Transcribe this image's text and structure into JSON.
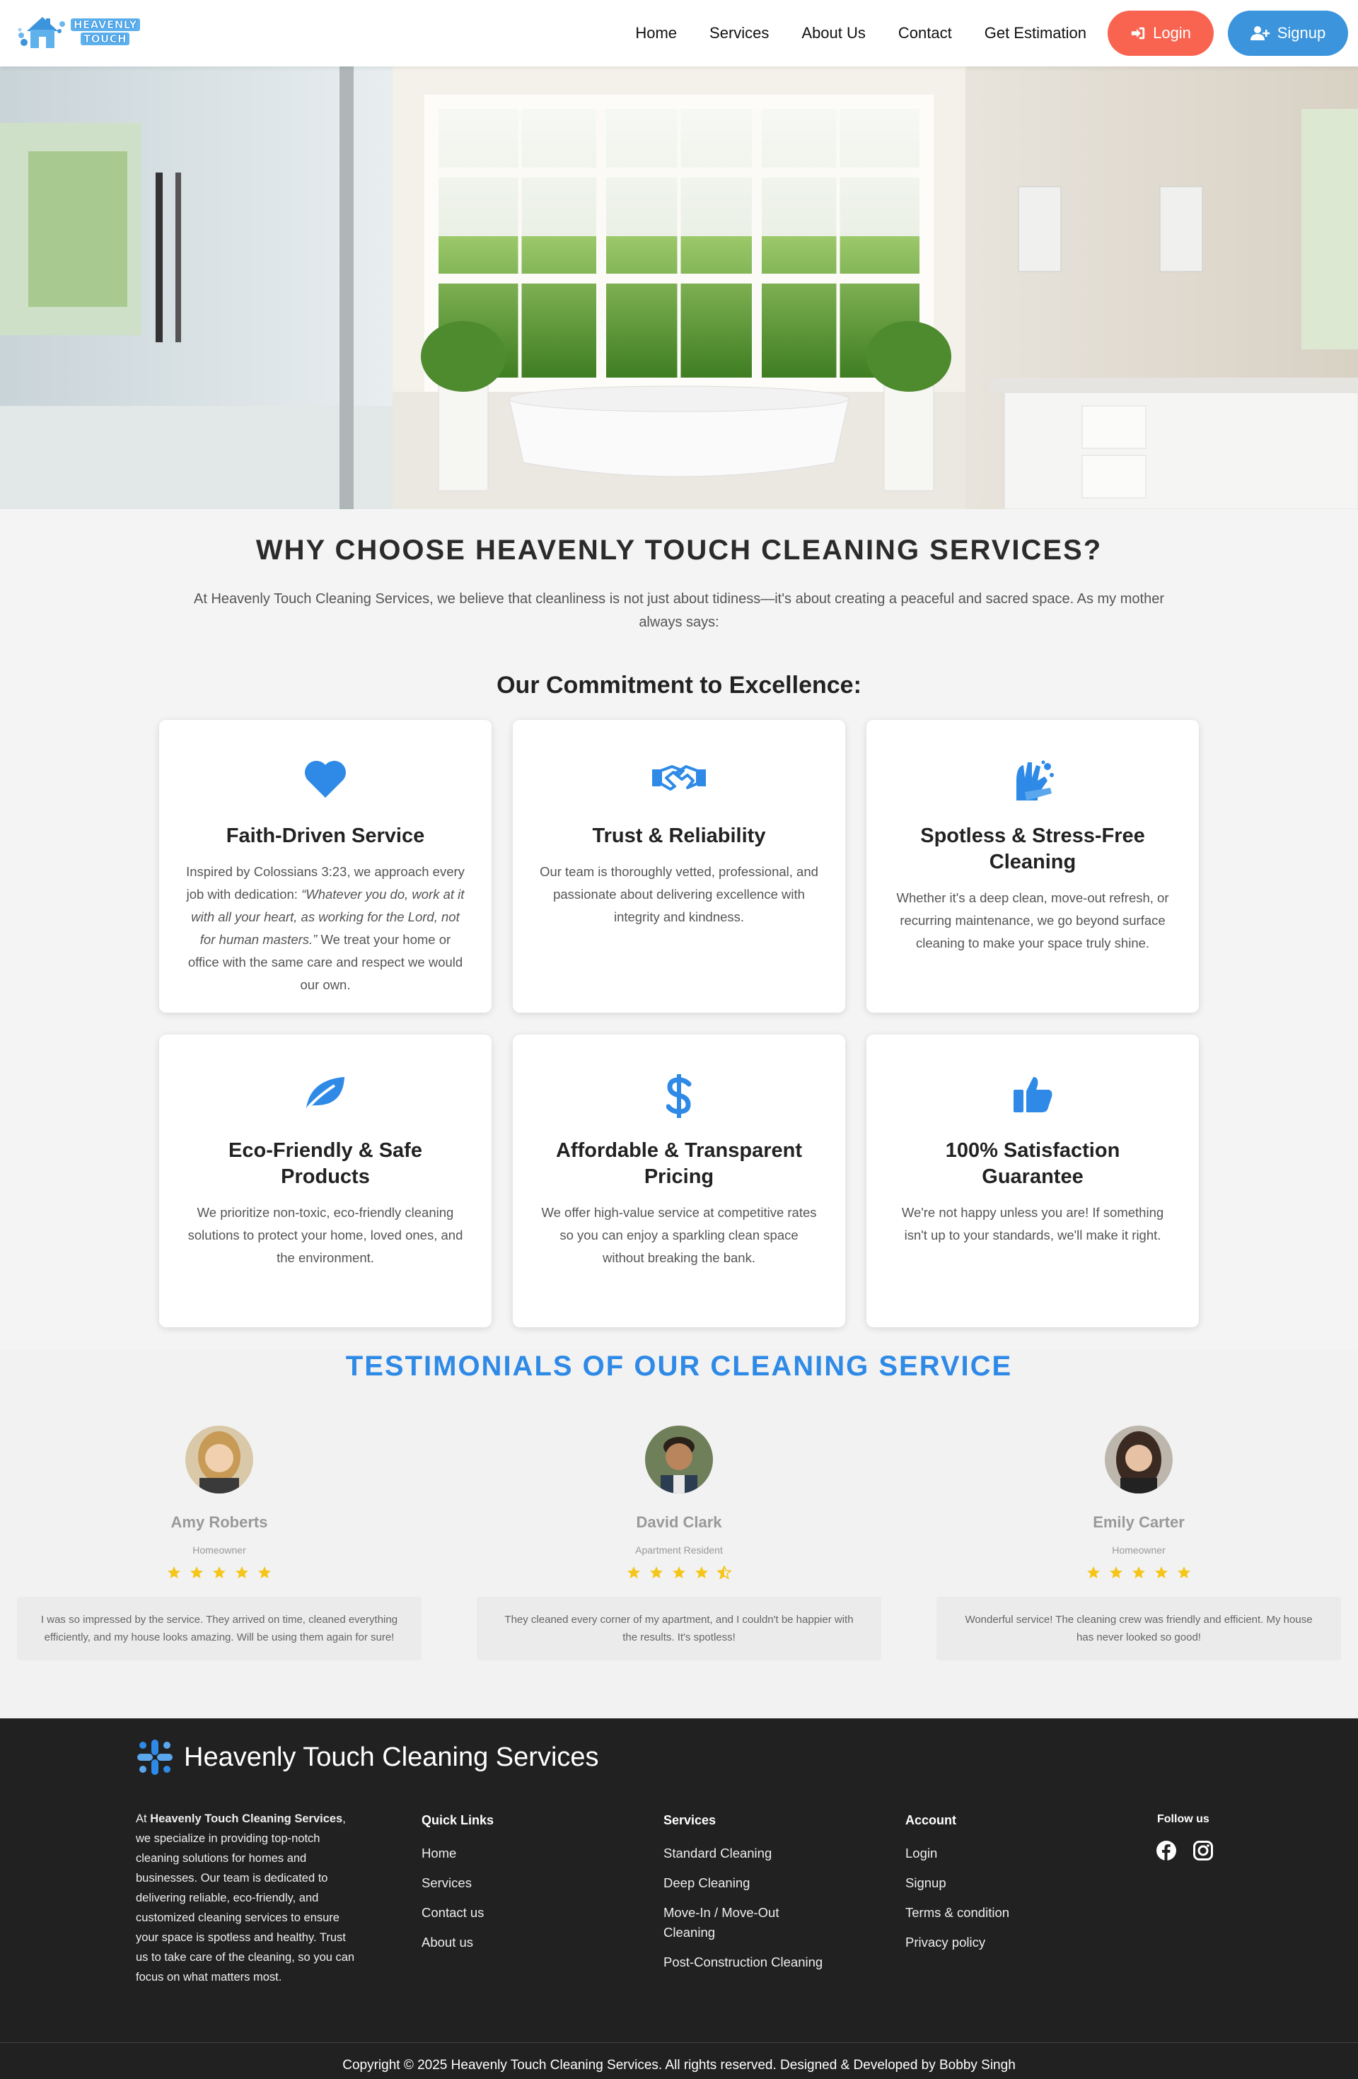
{
  "header": {
    "logo_line1": "HEAVENLY",
    "logo_line2": "TOUCH",
    "nav": [
      "Home",
      "Services",
      "About Us",
      "Contact",
      "Get Estimation"
    ],
    "login_label": "Login",
    "signup_label": "Signup"
  },
  "why": {
    "title": "WHY CHOOSE HEAVENLY TOUCH CLEANING SERVICES?",
    "intro": "At Heavenly Touch Cleaning Services, we believe that cleanliness is not just about tidiness—it's about creating a peaceful and sacred space. As my mother always says:",
    "commitment_title": "Our Commitment to Excellence:"
  },
  "cards": [
    {
      "icon": "heart-icon",
      "title": "Faith-Driven Service",
      "text_before": "Inspired by Colossians 3:23, we approach every job with dedication: ",
      "quote": "“Whatever you do, work at it with all your heart, as working for the Lord, not for human masters.”",
      "text_after": " We treat your home or office with the same care and respect we would our own."
    },
    {
      "icon": "handshake-icon",
      "title": "Trust & Reliability",
      "text": "Our team is thoroughly vetted, professional, and passionate about delivering excellence with integrity and kindness."
    },
    {
      "icon": "hands-clean-icon",
      "title": "Spotless & Stress-Free Cleaning",
      "text": "Whether it's a deep clean, move-out refresh, or recurring maintenance, we go beyond surface cleaning to make your space truly shine."
    },
    {
      "icon": "leaf-icon",
      "title": "Eco-Friendly & Safe Products",
      "text": "We prioritize non-toxic, eco-friendly cleaning solutions to protect your home, loved ones, and the environment."
    },
    {
      "icon": "dollar-icon",
      "title": "Affordable & Transparent Pricing",
      "text": "We offer high-value service at competitive rates so you can enjoy a sparkling clean space without breaking the bank."
    },
    {
      "icon": "thumbs-up-icon",
      "title": "100% Satisfaction Guarantee",
      "text": "We're not happy unless you are! If something isn't up to your standards, we'll make it right."
    }
  ],
  "testimonials": {
    "title": "TESTIMONIALS OF OUR CLEANING SERVICE",
    "items": [
      {
        "name": "Amy Roberts",
        "role": "Homeowner",
        "rating": 5,
        "quote": "I was so impressed by the service. They arrived on time, cleaned everything efficiently, and my house looks amazing. Will be using them again for sure!"
      },
      {
        "name": "David Clark",
        "role": "Apartment Resident",
        "rating": 4.5,
        "quote": "They cleaned every corner of my apartment, and I couldn't be happier with the results. It's spotless!"
      },
      {
        "name": "Emily Carter",
        "role": "Homeowner",
        "rating": 5,
        "quote": "Wonderful service! The cleaning crew was friendly and efficient. My house has never looked so good!"
      }
    ]
  },
  "footer": {
    "brand": "Heavenly Touch Cleaning Services",
    "about_prefix": "At ",
    "about_bold": "Heavenly Touch Cleaning Services",
    "about_rest": ", we specialize in providing top-notch cleaning solutions for homes and businesses. Our team is dedicated to delivering reliable, eco-friendly, and customized cleaning services to ensure your space is spotless and healthy. Trust us to take care of the cleaning, so you can focus on what matters most.",
    "quick_links_title": "Quick Links",
    "quick_links": [
      "Home",
      "Services",
      "Contact us",
      "About us"
    ],
    "services_title": "Services",
    "services": [
      "Standard Cleaning",
      "Deep Cleaning",
      "Move-In / Move-Out Cleaning",
      "Post-Construction Cleaning"
    ],
    "account_title": "Account",
    "account": [
      "Login",
      "Signup",
      "Terms & condition",
      "Privacy policy"
    ],
    "follow_title": "Follow us",
    "copyright": "Copyright © 2025 Heavenly Touch Cleaning Services. All rights reserved. Designed & Developed by Bobby Singh"
  },
  "colors": {
    "accent": "#2e8ae6",
    "login": "#f96450",
    "signup": "#3b94dc",
    "star": "#f5c518",
    "footer_bg": "#212121"
  }
}
